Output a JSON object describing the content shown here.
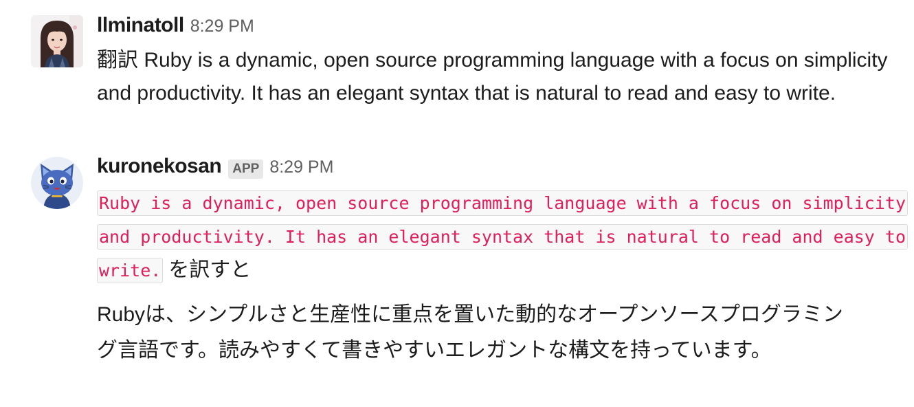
{
  "messages": [
    {
      "username": "llminatoll",
      "timestamp": "8:29 PM",
      "avatar_icon": "user-photo-avatar",
      "text": "翻訳 Ruby is a dynamic, open source programming language with a focus on simplicity and productivity. It has an elegant syntax that is natural to read and easy to write."
    },
    {
      "username": "kuronekosan",
      "badge": "APP",
      "timestamp": "8:29 PM",
      "avatar_icon": "blue-cat-avatar",
      "code": "Ruby is a dynamic, open source programming language with a focus on simplicity and productivity. It has an elegant syntax that is natural to read and easy to write.",
      "code_suffix": "を訳すと",
      "translation": "Rubyは、シンプルさと生産性に重点を置いた動的なオープンソースプログラミング言語です。読みやすくて書きやすいエレガントな構文を持っています。"
    }
  ],
  "colors": {
    "code_text": "#e01e5a",
    "code_bg": "#f8f8f8",
    "timestamp": "#616061",
    "badge_bg": "#e8e8e8"
  }
}
